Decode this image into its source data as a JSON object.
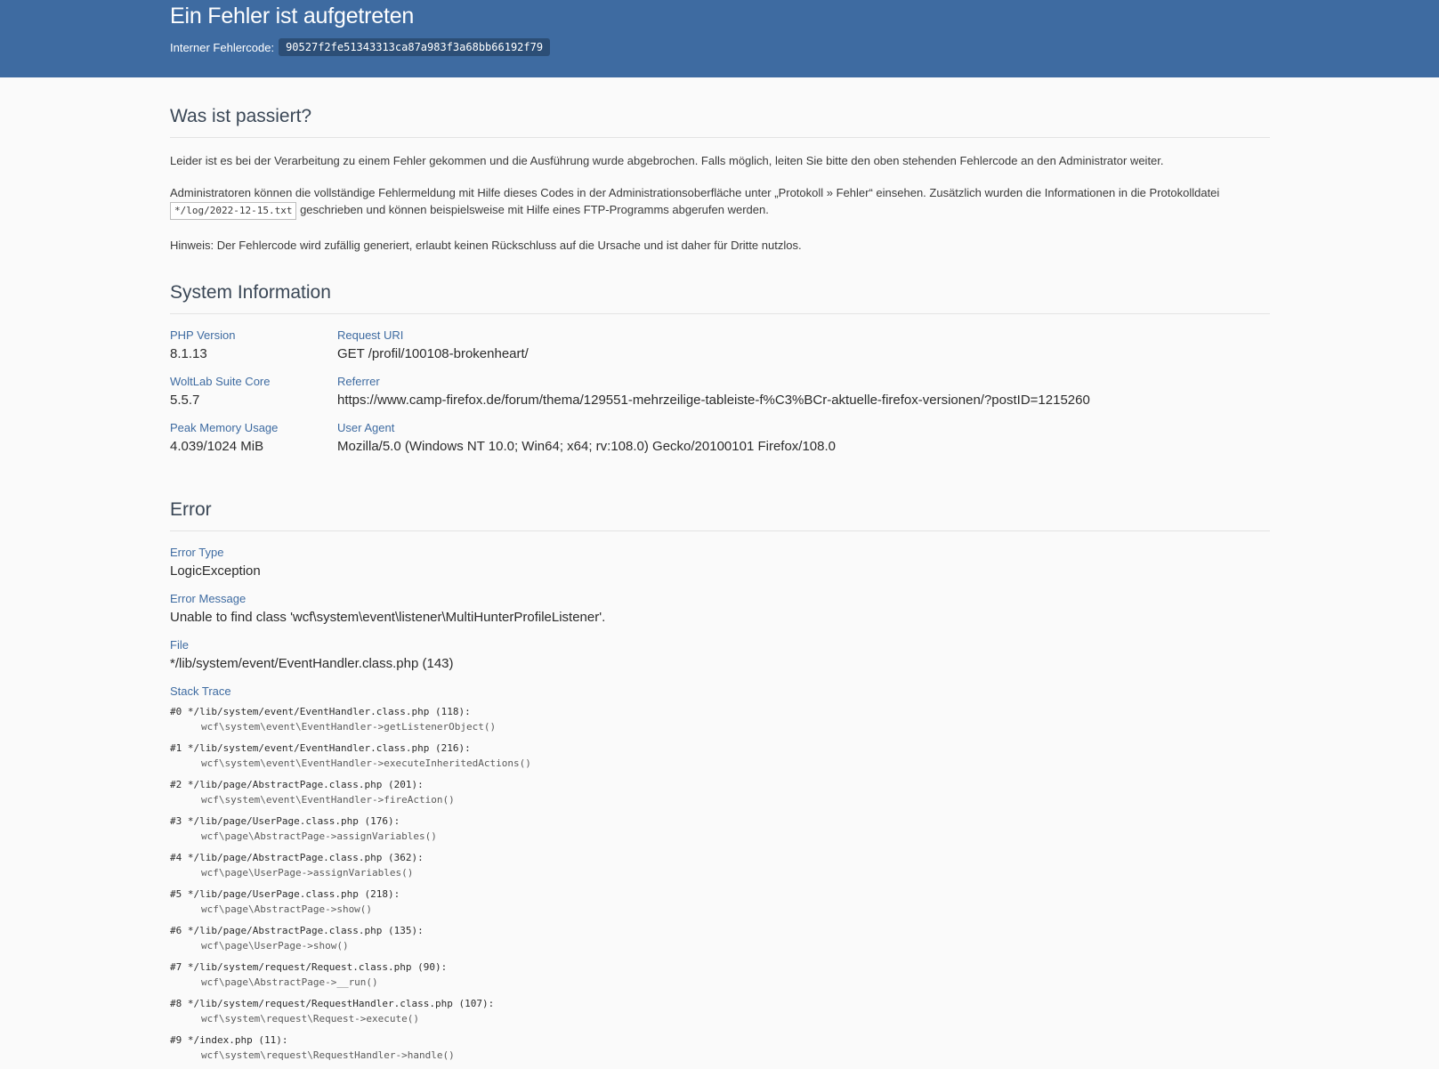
{
  "header": {
    "title": "Ein Fehler ist aufgetreten",
    "code_label": "Interner Fehlercode:",
    "code": "90527f2fe51343313ca87a983f3a68bb66192f79"
  },
  "what_happened": {
    "title": "Was ist passiert?",
    "p1": "Leider ist es bei der Verarbeitung zu einem Fehler gekommen und die Ausführung wurde abgebrochen. Falls möglich, leiten Sie bitte den oben stehenden Fehlercode an den Administrator weiter.",
    "p2_before": "Administratoren können die vollständige Fehlermeldung mit Hilfe dieses Codes in der Administrationsoberfläche unter „Protokoll » Fehler“ einsehen. Zusätzlich wurden die Informationen in die Protokolldatei ",
    "p2_file": "*/log/2022-12-15.txt",
    "p2_after": " geschrieben und können beispielsweise mit Hilfe eines FTP-Programms abgerufen werden.",
    "p3": "Hinweis: Der Fehlercode wird zufällig generiert, erlaubt keinen Rückschluss auf die Ursache und ist daher für Dritte nutzlos."
  },
  "system_info": {
    "title": "System Information",
    "php_version": {
      "label": "PHP Version",
      "value": "8.1.13"
    },
    "wsc": {
      "label": "WoltLab Suite Core",
      "value": "5.5.7"
    },
    "memory": {
      "label": "Peak Memory Usage",
      "value": "4.039/1024 MiB"
    },
    "request_uri": {
      "label": "Request URI",
      "value": "GET /profil/100108-brokenheart/"
    },
    "referrer": {
      "label": "Referrer",
      "value": "https://www.camp-firefox.de/forum/thema/129551-mehrzeilige-tableiste-f%C3%BCr-aktuelle-firefox-versionen/?postID=1215260"
    },
    "user_agent": {
      "label": "User Agent",
      "value": "Mozilla/5.0 (Windows NT 10.0; Win64; x64; rv:108.0) Gecko/20100101 Firefox/108.0"
    }
  },
  "error": {
    "title": "Error",
    "type": {
      "label": "Error Type",
      "value": "LogicException"
    },
    "message": {
      "label": "Error Message",
      "value": "Unable to find class 'wcf\\system\\event\\listener\\MultiHunterProfileListener'."
    },
    "file": {
      "label": "File",
      "value": "*/lib/system/event/EventHandler.class.php (143)"
    },
    "stack_label": "Stack Trace",
    "trace": [
      {
        "loc": "#0 */lib/system/event/EventHandler.class.php (118):",
        "call": "wcf\\system\\event\\EventHandler->getListenerObject()"
      },
      {
        "loc": "#1 */lib/system/event/EventHandler.class.php (216):",
        "call": "wcf\\system\\event\\EventHandler->executeInheritedActions()"
      },
      {
        "loc": "#2 */lib/page/AbstractPage.class.php (201):",
        "call": "wcf\\system\\event\\EventHandler->fireAction()"
      },
      {
        "loc": "#3 */lib/page/UserPage.class.php (176):",
        "call": "wcf\\page\\AbstractPage->assignVariables()"
      },
      {
        "loc": "#4 */lib/page/AbstractPage.class.php (362):",
        "call": "wcf\\page\\UserPage->assignVariables()"
      },
      {
        "loc": "#5 */lib/page/UserPage.class.php (218):",
        "call": "wcf\\page\\AbstractPage->show()"
      },
      {
        "loc": "#6 */lib/page/AbstractPage.class.php (135):",
        "call": "wcf\\page\\UserPage->show()"
      },
      {
        "loc": "#7 */lib/system/request/Request.class.php (90):",
        "call": "wcf\\page\\AbstractPage->__run()"
      },
      {
        "loc": "#8 */lib/system/request/RequestHandler.class.php (107):",
        "call": "wcf\\system\\request\\Request->execute()"
      },
      {
        "loc": "#9 */index.php (11):",
        "call": "wcf\\system\\request\\RequestHandler->handle()"
      }
    ]
  }
}
